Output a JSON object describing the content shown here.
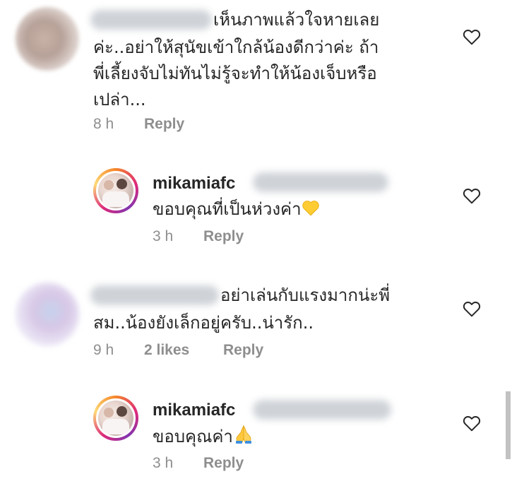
{
  "comments": [
    {
      "text_lines": [
        "เห็นภาพแล้วใจหายเลย",
        "ค่ะ..อย่าให้สุนัขเข้าใกล้น้องดีกว่าค่ะ ถ้า",
        "พี่เลี้ยงจับไม่ทันไม่รู้จะทำให้น้องเจ็บหรือ",
        "เปล่า..."
      ],
      "time": "8 h",
      "reply_label": "Reply"
    },
    {
      "username": "mikamiafc",
      "text": "ขอบคุณที่เป็นห่วงค่า",
      "emoji_icon": "yellow-heart-icon",
      "time": "3 h",
      "reply_label": "Reply"
    },
    {
      "text_lines": [
        "อย่าเล่นกับแรงมากน่ะพี่",
        "สม..น้องยังเล็กอยู่ครับ..น่ารัก.."
      ],
      "time": "9 h",
      "likes": "2 likes",
      "reply_label": "Reply"
    },
    {
      "username": "mikamiafc",
      "text": "ขอบคุณค่า",
      "emoji_icon": "folded-hands-icon",
      "time": "3 h",
      "reply_label": "Reply"
    }
  ],
  "icons": {
    "like": "heart-outline-icon"
  },
  "colors": {
    "text": "#262626",
    "meta": "#8e8e8e",
    "yellow_heart": "#FFCC33",
    "story_ring": [
      "#f58529",
      "#dd2a7b",
      "#8134af",
      "#feda77"
    ]
  }
}
